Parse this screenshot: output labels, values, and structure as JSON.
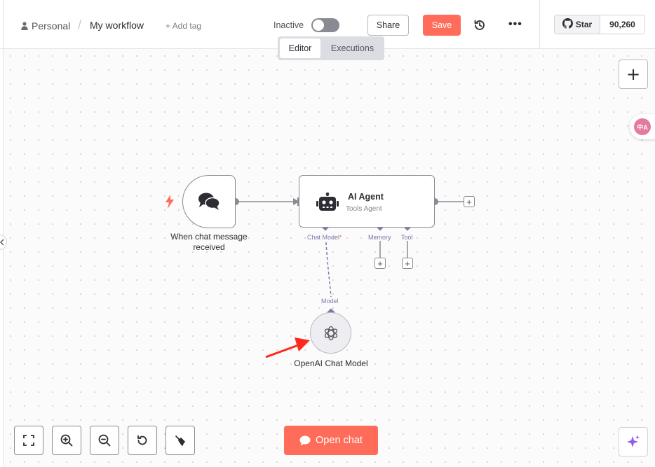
{
  "header": {
    "breadcrumb_project": "Personal",
    "breadcrumb_separator": "/",
    "workflow_name": "My workflow",
    "add_tag_label": "+ Add tag",
    "status_label": "Inactive",
    "active": false,
    "share_label": "Share",
    "save_label": "Save",
    "more_label": "•••",
    "github_star_label": "Star",
    "github_star_count": "90,260"
  },
  "tabs": [
    {
      "label": "Editor",
      "selected": true
    },
    {
      "label": "Executions",
      "selected": false
    }
  ],
  "canvas": {
    "nodes": {
      "trigger": {
        "label": "When chat message received",
        "icon": "chat-bubbles-icon"
      },
      "agent": {
        "title": "AI Agent",
        "subtitle": "Tools Agent",
        "icon": "robot-icon"
      },
      "model": {
        "label": "OpenAI Chat Model",
        "icon": "openai-icon"
      }
    },
    "handles": {
      "chat_model": "Chat Model",
      "required_marker": "*",
      "memory": "Memory",
      "tool": "Tool",
      "model_input": "Model"
    },
    "add_plus": "+"
  },
  "translate_badge_text": "中A",
  "controls": {
    "open_chat_label": "Open chat",
    "add_node_label": "+"
  },
  "colors": {
    "accent": "#ff6d5a",
    "handle": "#7b7ba8",
    "border": "#8a8a92"
  }
}
